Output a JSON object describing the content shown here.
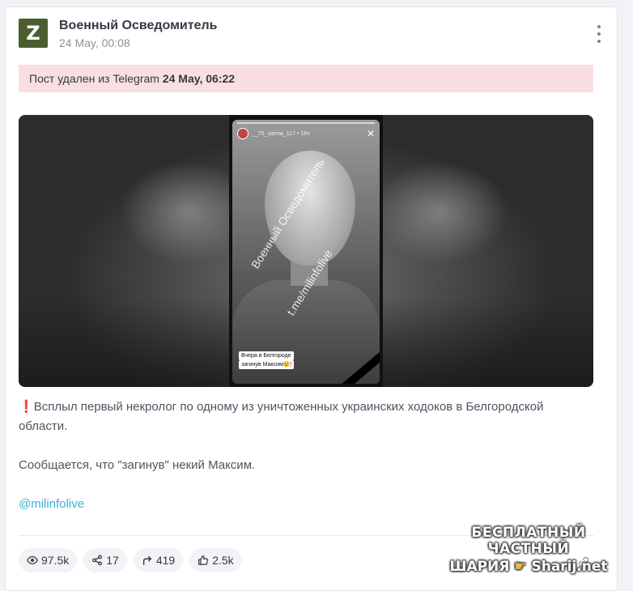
{
  "post": {
    "channel": {
      "name": "Военный Осведомитель",
      "avatar_letter": "Z"
    },
    "date": "24 May, 00:08",
    "deleted_notice": {
      "prefix": "Пост удален из Telegram",
      "date": "24 May, 06:22"
    },
    "media": {
      "story_user": "__75_sarma_117 • 16ч",
      "watermark_line1": "Военный Осведомитель",
      "watermark_line2": "t.me/milinfolive",
      "caption_line1": "Вчера в Белгороде",
      "caption_line2": "загинув Максим😢🕯"
    },
    "text": {
      "alert_icon": "❗",
      "paragraph1": "Всплыл первый некролог по одному из уничтоженных украинских ходоков в Белгородской области.",
      "paragraph2": "Сообщается, что \"загинув\" некий Максим.",
      "mention": "@milinfolive"
    },
    "stats": {
      "views": "97.5k",
      "shares": "17",
      "forwards": "419",
      "reactions": "2.5k"
    }
  },
  "site_watermark": {
    "line1": "БЕСПЛАТНЫЙ ЧАСТНЫЙ",
    "line2_left": "ШАРИЯ",
    "line2_right": "Sharij.net"
  },
  "colors": {
    "banner": "#f9dfe2",
    "mention": "#3ab0d2",
    "avatar": "#4a5e2f"
  }
}
